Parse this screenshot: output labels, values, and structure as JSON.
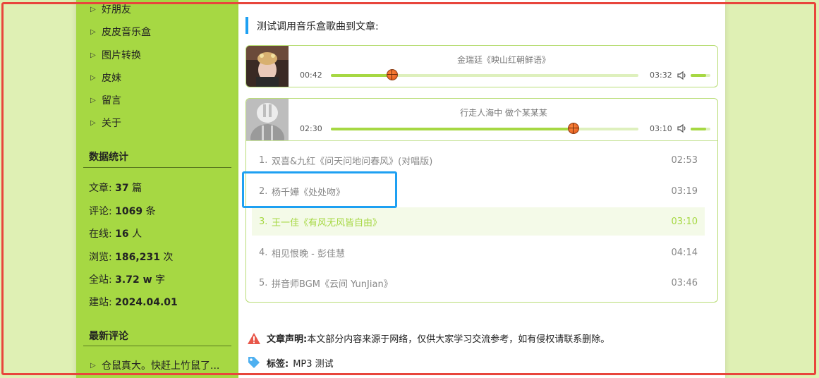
{
  "sidebar": {
    "nav": [
      {
        "label": "好朋友"
      },
      {
        "label": "皮皮音乐盒"
      },
      {
        "label": "图片转换"
      },
      {
        "label": "皮妹"
      },
      {
        "label": "留言"
      },
      {
        "label": "关于"
      }
    ],
    "stats_title": "数据统计",
    "stats": [
      {
        "label": "文章: ",
        "value": "37",
        "unit": " 篇"
      },
      {
        "label": "评论: ",
        "value": "1069",
        "unit": " 条"
      },
      {
        "label": "在线: ",
        "value": "16",
        "unit": " 人"
      },
      {
        "label": "浏览: ",
        "value": "186,231",
        "unit": " 次"
      },
      {
        "label": "全站: ",
        "value": "3.72 w",
        "unit": " 字"
      },
      {
        "label": "建站: ",
        "value": "2024.04.01",
        "unit": ""
      }
    ],
    "comments_title": "最新评论",
    "comments": [
      {
        "text": "仓鼠真大。快赶上竹鼠了..."
      }
    ]
  },
  "main": {
    "top_cut_text": "…",
    "quote": "测试调用音乐盒歌曲到文章:",
    "player1": {
      "title": "金瑞廷《映山红朝鲜语》",
      "current": "00:42",
      "total": "03:32",
      "progress": 0.2
    },
    "player2": {
      "title": "行走人海中 做个某某某",
      "current": "02:30",
      "total": "03:10",
      "progress": 0.79
    },
    "playlist": [
      {
        "num": "1.",
        "name": "双喜&九红《问天问地问春风》(对唱版)",
        "dur": "02:53"
      },
      {
        "num": "2.",
        "name": "杨千嬅《处处吻》",
        "dur": "03:19"
      },
      {
        "num": "3.",
        "name": "王一佳《有风无风皆自由》",
        "dur": "03:10"
      },
      {
        "num": "4.",
        "name": "相见恨晚 - 彭佳慧",
        "dur": "04:14"
      },
      {
        "num": "5.",
        "name": "拼音师BGM《云间 YunJian》",
        "dur": "03:46"
      }
    ],
    "notice_label": "文章声明:",
    "notice_text": "本文部分内容来源于网络，仅供大家学习交流参考，如有侵权请联系删除。",
    "tags_label": "标签:",
    "tags_text": "MP3 测试"
  },
  "colors": {
    "accent": "#a6d843",
    "page_bg": "#dff0b4",
    "highlight_blue": "#1ea0f2",
    "outline_red": "#e8453c"
  }
}
